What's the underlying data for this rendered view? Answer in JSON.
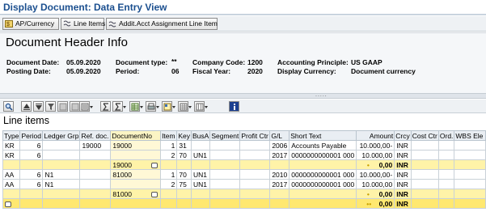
{
  "window": {
    "title": "Display Document: Data Entry View"
  },
  "app_toolbar": {
    "buttons": [
      {
        "label": "AP/Currency",
        "icon": "currency-icon"
      },
      {
        "label": "Line Items",
        "icon": "line-items-icon"
      },
      {
        "label": "Addit.Acct Assignment Line Item",
        "icon": "assignment-icon"
      }
    ]
  },
  "header": {
    "title": "Document Header Info",
    "fields": {
      "document_date_label": "Document Date:",
      "document_date": "05.09.2020",
      "posting_date_label": "Posting Date:",
      "posting_date": "05.09.2020",
      "document_type_label": "Document type:",
      "document_type": "**",
      "period_label": "Period:",
      "period": "06",
      "company_code_label": "Company Code:",
      "company_code": "1200",
      "fiscal_year_label": "Fiscal Year:",
      "fiscal_year": "2020",
      "accounting_principle_label": "Accounting Principle:",
      "accounting_principle": "US GAAP",
      "display_currency_label": "Display Currency:",
      "display_currency": "Document currency"
    }
  },
  "line_items": {
    "title": "Line items",
    "columns": [
      "Type",
      "Period",
      "Ledger Grp",
      "Ref. doc.",
      "DocumentNo",
      "Item",
      "Key",
      "BusA",
      "Segment",
      "Profit Ctr",
      "G/L",
      "Short Text",
      "Amount",
      "Crcy",
      "Cost Ctr",
      "Ord.",
      "WBS Ele"
    ],
    "rows": [
      {
        "type": "KR",
        "period": "6",
        "ledger": "",
        "ref": "19000",
        "docno": "19000",
        "item": "1",
        "key": "31",
        "busa": "",
        "segment": "",
        "profit": "",
        "gl": "2006",
        "text": "Accounts Payable",
        "amount": "10.000,00-",
        "crcy": "INR"
      },
      {
        "type": "KR",
        "period": "6",
        "ledger": "",
        "ref": "",
        "docno": "",
        "item": "2",
        "key": "70",
        "busa": "UN1",
        "segment": "",
        "profit": "",
        "gl": "2017",
        "text": "0000000000001 000",
        "amount": "10.000,00",
        "crcy": "INR"
      }
    ],
    "subtotal1": {
      "docno": "19000",
      "amount": "0,00",
      "crcy": "INR"
    },
    "rows2": [
      {
        "type": "AA",
        "period": "6",
        "ledger": "N1",
        "ref": "",
        "docno": "81000",
        "item": "1",
        "key": "70",
        "busa": "UN1",
        "segment": "",
        "profit": "",
        "gl": "2010",
        "text": "0000000000001 000",
        "amount": "10.000,00-",
        "crcy": "INR"
      },
      {
        "type": "AA",
        "period": "6",
        "ledger": "N1",
        "ref": "",
        "docno": "",
        "item": "2",
        "key": "75",
        "busa": "UN1",
        "segment": "",
        "profit": "",
        "gl": "2017",
        "text": "0000000000001 000",
        "amount": "10.000,00",
        "crcy": "INR"
      }
    ],
    "subtotal2": {
      "docno": "81000",
      "amount": "0,00",
      "crcy": "INR"
    },
    "grand_total": {
      "amount": "0,00",
      "crcy": "INR"
    }
  },
  "grip": "....."
}
